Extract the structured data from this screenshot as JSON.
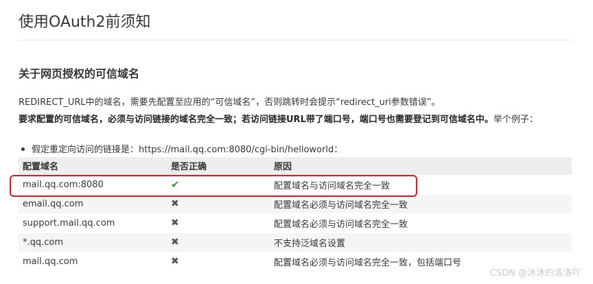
{
  "page_title": "使用OAuth2前须知",
  "section_title": "关于网页授权的可信域名",
  "para1": "REDIRECT_URL中的域名，需要先配置至应用的“可信域名”，否则跳转时会提示“redirect_uri参数错误”。",
  "para2_bold": "要求配置的可信域名，必须与访问链接的域名完全一致；若访问链接URL带了端口号，端口号也需要登记到可信域名中。",
  "para2_tail": "举个例子：",
  "bullet": "假定重定向访问的链接是：https://mail.qq.com:8080/cgi-bin/helloworld：",
  "table": {
    "headers": [
      "配置域名",
      "是否正确",
      "原因"
    ],
    "rows": [
      {
        "domain": "mail.qq.com:8080",
        "correct": "✔",
        "reason": "配置域名与访问域名完全一致"
      },
      {
        "domain": "email.qq.com",
        "correct": "✖",
        "reason": "配置域名必须与访问域名完全一致"
      },
      {
        "domain": "support.mail.qq.com",
        "correct": "✖",
        "reason": "配置域名必须与访问域名完全一致"
      },
      {
        "domain": "*.qq.com",
        "correct": "✖",
        "reason": "不支持泛域名设置"
      },
      {
        "domain": "mail.qq.com",
        "correct": "✖",
        "reason": "配置域名必须与访问域名完全一致，包括端口号"
      }
    ]
  },
  "colors": {
    "highlight": "#e6161e",
    "check": "#2e9e3e"
  },
  "watermark": "CSDN @沐沐的洛洛吖"
}
